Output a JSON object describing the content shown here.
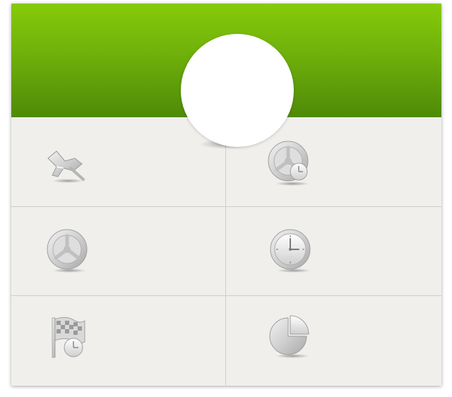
{
  "header": {
    "avatar_label": ""
  },
  "tiles": [
    {
      "icon": "pedals-icon",
      "label": ""
    },
    {
      "icon": "wheel-clock-icon",
      "label": ""
    },
    {
      "icon": "steering-wheel-icon",
      "label": ""
    },
    {
      "icon": "stopwatch-icon",
      "label": ""
    },
    {
      "icon": "checkered-flag-clock-icon",
      "label": ""
    },
    {
      "icon": "pie-chart-icon",
      "label": ""
    }
  ],
  "colors": {
    "header_top": "#86cb0a",
    "header_bottom": "#4f8a08",
    "panel_background": "#f0efec",
    "divider": "#cfcdca",
    "icon_gray": "#c4c4c4"
  }
}
